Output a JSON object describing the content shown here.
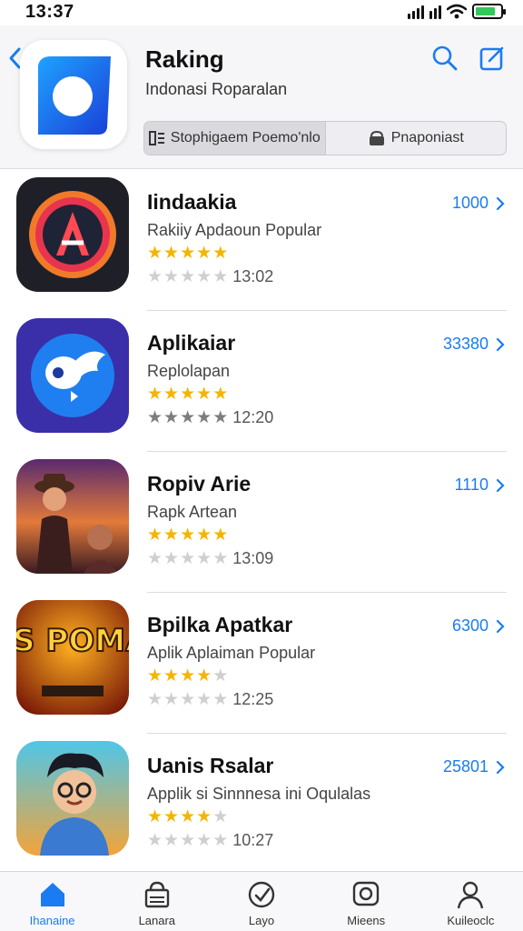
{
  "status_bar": {
    "time": "13:37"
  },
  "header": {
    "title": "Raking",
    "subtitle": "Indonasi Roparalan",
    "segments": [
      {
        "label": "Stophigaem Poemo'nlo",
        "icon": "filter-icon",
        "active": true
      },
      {
        "label": "Pnaponiast",
        "icon": "bag-icon",
        "active": false
      }
    ]
  },
  "apps": [
    {
      "name": "Iindaakia",
      "description": "Rakiiy Apdaoun Popular",
      "rating": 4.5,
      "time": "13:02",
      "count": "1000"
    },
    {
      "name": "Aplikaiar",
      "description": "Replolapan",
      "rating": 4.5,
      "time": "12:20",
      "count": "33380"
    },
    {
      "name": "Ropiv Arie",
      "description": "Rapk Artean",
      "rating": 4.5,
      "time": "13:09",
      "count": "1110"
    },
    {
      "name": "Bpilka Apatkar",
      "description": "Aplik Aplaiman Popular",
      "rating": 4.0,
      "time": "12:25",
      "count": "6300"
    },
    {
      "name": "Uanis Rsalar",
      "description": "Applik si Sinnnesa ini Oqulalas",
      "rating": 4.0,
      "time": "10:27",
      "count": "25801"
    }
  ],
  "app_icon_captions": {
    "bpilka": "MIAS POMAOA"
  },
  "tabs": [
    {
      "label": "Ihanaine",
      "icon": "home-icon",
      "active": true
    },
    {
      "label": "Lanara",
      "icon": "store-icon",
      "active": false
    },
    {
      "label": "Layo",
      "icon": "check-circle-icon",
      "active": false
    },
    {
      "label": "Mieens",
      "icon": "camera-icon",
      "active": false
    },
    {
      "label": "Kuileoclc",
      "icon": "person-icon",
      "active": false
    }
  ],
  "colors": {
    "accent": "#1a7cf0",
    "star": "#f5b400",
    "battery": "#34c759"
  }
}
